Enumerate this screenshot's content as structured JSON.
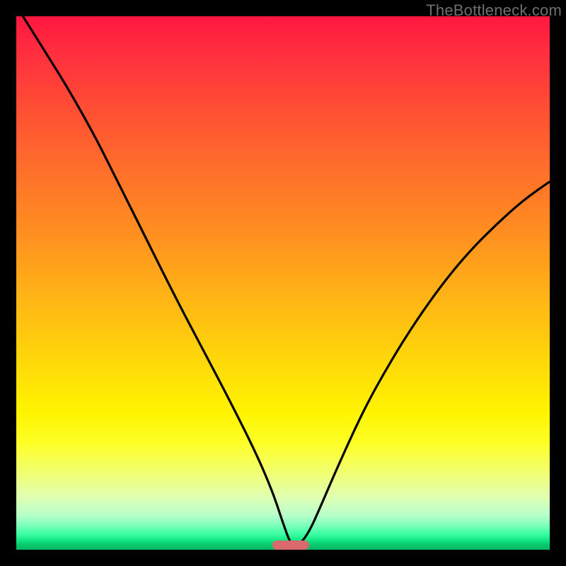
{
  "watermark": "TheBottleneck.com",
  "chart_data": {
    "type": "line",
    "title": "",
    "xlabel": "",
    "ylabel": "",
    "xlim": [
      0,
      100
    ],
    "ylim": [
      0,
      100
    ],
    "grid": false,
    "legend": false,
    "series": [
      {
        "name": "bottleneck-curve",
        "x": [
          0,
          5,
          10,
          15,
          18,
          20,
          25,
          30,
          35,
          40,
          45,
          48,
          50,
          51.5,
          53,
          55,
          57,
          60,
          65,
          70,
          75,
          80,
          85,
          90,
          95,
          100
        ],
        "y": [
          102,
          94,
          86,
          77,
          71,
          67,
          57,
          47,
          37.5,
          28,
          18,
          11,
          5,
          0.8,
          0.8,
          3.5,
          8,
          15,
          26,
          35,
          43,
          50,
          56,
          61,
          65.5,
          69
        ]
      }
    ],
    "marker": {
      "x": 51.5,
      "y": 0.8,
      "color": "#d86a6e"
    },
    "background_gradient": {
      "direction": "vertical",
      "stops": [
        {
          "pos": 0.0,
          "color": "#ff163f"
        },
        {
          "pos": 0.5,
          "color": "#ffb216"
        },
        {
          "pos": 0.78,
          "color": "#fdff26"
        },
        {
          "pos": 0.95,
          "color": "#7affba"
        },
        {
          "pos": 1.0,
          "color": "#06b864"
        }
      ]
    }
  }
}
